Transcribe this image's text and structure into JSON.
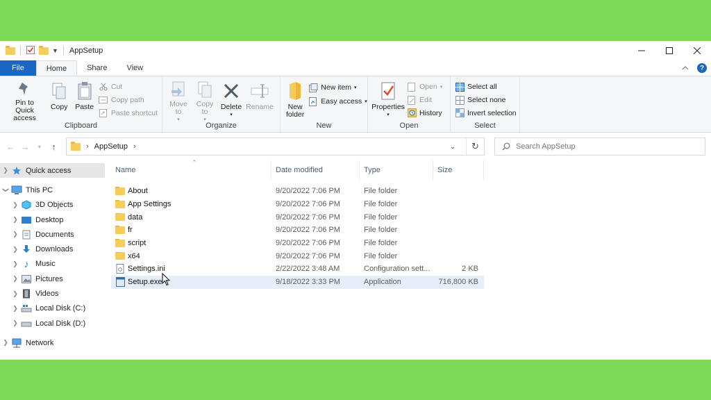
{
  "window": {
    "title": "AppSetup"
  },
  "tabs": {
    "file": "File",
    "home": "Home",
    "share": "Share",
    "view": "View"
  },
  "ribbon": {
    "clipboard": {
      "label": "Clipboard",
      "pin": "Pin to Quick access",
      "copy": "Copy",
      "paste": "Paste",
      "cut": "Cut",
      "copy_path": "Copy path",
      "paste_shortcut": "Paste shortcut"
    },
    "organize": {
      "label": "Organize",
      "move_to": "Move to",
      "copy_to": "Copy to",
      "delete": "Delete",
      "rename": "Rename"
    },
    "new": {
      "label": "New",
      "new_folder": "New folder",
      "new_item": "New item",
      "easy_access": "Easy access"
    },
    "open": {
      "label": "Open",
      "properties": "Properties",
      "open": "Open",
      "edit": "Edit",
      "history": "History"
    },
    "select": {
      "label": "Select",
      "select_all": "Select all",
      "select_none": "Select none",
      "invert": "Invert selection"
    }
  },
  "address": {
    "crumb": "AppSetup"
  },
  "search": {
    "placeholder": "Search AppSetup"
  },
  "nav": {
    "quick_access": "Quick access",
    "this_pc": "This PC",
    "objects3d": "3D Objects",
    "desktop": "Desktop",
    "documents": "Documents",
    "downloads": "Downloads",
    "music": "Music",
    "pictures": "Pictures",
    "videos": "Videos",
    "local_c": "Local Disk (C:)",
    "local_d": "Local Disk (D:)",
    "network": "Network"
  },
  "columns": {
    "name": "Name",
    "date": "Date modified",
    "type": "Type",
    "size": "Size"
  },
  "files": [
    {
      "name": "About",
      "date": "9/20/2022 7:06 PM",
      "type": "File folder",
      "size": ""
    },
    {
      "name": "App Settings",
      "date": "9/20/2022 7:06 PM",
      "type": "File folder",
      "size": ""
    },
    {
      "name": "data",
      "date": "9/20/2022 7:06 PM",
      "type": "File folder",
      "size": ""
    },
    {
      "name": "fr",
      "date": "9/20/2022 7:06 PM",
      "type": "File folder",
      "size": ""
    },
    {
      "name": "script",
      "date": "9/20/2022 7:06 PM",
      "type": "File folder",
      "size": ""
    },
    {
      "name": "x64",
      "date": "9/20/2022 7:06 PM",
      "type": "File folder",
      "size": ""
    },
    {
      "name": "Settings.ini",
      "date": "2/22/2022 3:48 AM",
      "type": "Configuration sett...",
      "size": "2 KB"
    },
    {
      "name": "Setup.exe",
      "date": "9/18/2022 3:33 PM",
      "type": "Application",
      "size": "716,800 KB"
    }
  ]
}
